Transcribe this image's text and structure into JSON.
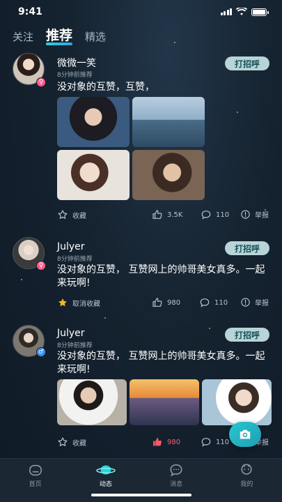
{
  "status_bar": {
    "time": "9:41"
  },
  "tabs": [
    {
      "label": "关注"
    },
    {
      "label": "推荐",
      "active": true
    },
    {
      "label": "精选"
    }
  ],
  "posts": [
    {
      "name": "微微一笑",
      "time": "8分钟前推荐",
      "gender": "female",
      "greet": "打招呼",
      "content": "没对象的互赞，互赞，",
      "photos": [
        "portrait-dark-hair",
        "seaside-birds",
        "woman-lying-down",
        "woman-sunlight"
      ],
      "favorite": {
        "label": "收藏",
        "active": false
      },
      "likes": "3.5K",
      "comments": "110",
      "report": "举报"
    },
    {
      "name": "Julyer",
      "time": "8分钟前推荐",
      "gender": "female",
      "greet": "打招呼",
      "content": "没对象的互赞， 互赞网上的帅哥美女真多。一起来玩啊!",
      "photos": [],
      "favorite": {
        "label": "取消收藏",
        "active": true
      },
      "likes": "980",
      "comments": "110",
      "report": "举报"
    },
    {
      "name": "Julyer",
      "time": "8分钟前推荐",
      "gender": "male",
      "greet": "打招呼",
      "content": "没对象的互赞， 互赞网上的帅哥美女真多。一起来玩啊!",
      "photos": [
        "man-white-shirt",
        "sunset-sea",
        "boy-outdoor"
      ],
      "favorite": {
        "label": "收藏",
        "active": false
      },
      "likes": "980",
      "liked": true,
      "comments": "110",
      "report": "举报"
    }
  ],
  "bottom_nav": [
    {
      "label": "首页",
      "icon": "home-icon"
    },
    {
      "label": "动态",
      "icon": "planet-icon",
      "active": true
    },
    {
      "label": "消息",
      "icon": "message-icon"
    },
    {
      "label": "我的",
      "icon": "profile-icon"
    }
  ],
  "colors": {
    "accent": "#2bd4d8",
    "greet_button": "#b8d4d6",
    "like_red": "#ff5a6a",
    "favorite_gold": "#f2b62a"
  }
}
